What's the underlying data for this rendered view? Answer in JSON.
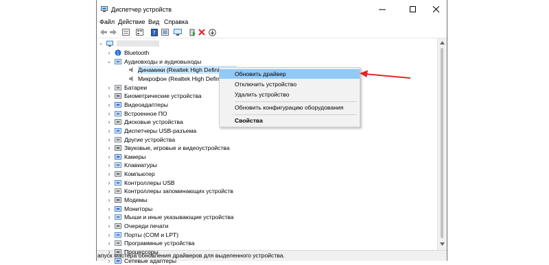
{
  "window": {
    "title": "Диспетчер устройств",
    "controls": [
      "–",
      "☐",
      "✕"
    ]
  },
  "menu": [
    "Файл",
    "Действие",
    "Вид",
    "Справка"
  ],
  "toolbar": {
    "icons": [
      "back-arrow-icon",
      "forward-arrow-icon",
      "properties-icon",
      "list-icon",
      "help-icon",
      "show-hidden-icon",
      "scan-monitor-icon",
      "update-driver-icon",
      "uninstall-x-icon",
      "download-icon"
    ]
  },
  "tree": {
    "root_name": "",
    "items": [
      {
        "label": "Bluetooth",
        "expanded": false
      },
      {
        "label": "Аудиовходы и аудиовыходы",
        "expanded": true
      },
      {
        "label": "Динамики (Realtek High Definition A",
        "child": true,
        "selected": true
      },
      {
        "label": "Микрофон (Realtek High Definition A",
        "child": true
      },
      {
        "label": "Батареи"
      },
      {
        "label": "Биометрические устройства"
      },
      {
        "label": "Видеоадаптеры"
      },
      {
        "label": "Встроенное ПО"
      },
      {
        "label": "Дисковые устройства"
      },
      {
        "label": "Диспетчеры USB-разъема"
      },
      {
        "label": "Другие устройства"
      },
      {
        "label": "Звуковые, игровые и видеоустройства"
      },
      {
        "label": "Камеры"
      },
      {
        "label": "Клавиатуры"
      },
      {
        "label": "Компьютер"
      },
      {
        "label": "Контроллеры USB"
      },
      {
        "label": "Контроллеры запоминающих устройств"
      },
      {
        "label": "Модемы"
      },
      {
        "label": "Мониторы"
      },
      {
        "label": "Мыши и иные указывающие устройства"
      },
      {
        "label": "Очереди печати"
      },
      {
        "label": "Порты (COM и LPT)"
      },
      {
        "label": "Программные устройства"
      },
      {
        "label": "Процессоры"
      },
      {
        "label": "Сетевые адаптеры"
      }
    ]
  },
  "context_menu": {
    "items": [
      {
        "label": "Обновить драйвер",
        "highlighted": true
      },
      {
        "label": "Отключить устройство"
      },
      {
        "label": "Удалить устройство"
      },
      {
        "label": "Обновить конфигурацию оборудования"
      },
      {
        "label": "Свойства",
        "bold": true
      }
    ]
  },
  "status": "апуск мастера обновления драйверов для выделенного устройства.",
  "colors": {
    "highlight": "#91c9f7",
    "selected_bg": "#cce8ff",
    "arrow": "#e0262a"
  }
}
